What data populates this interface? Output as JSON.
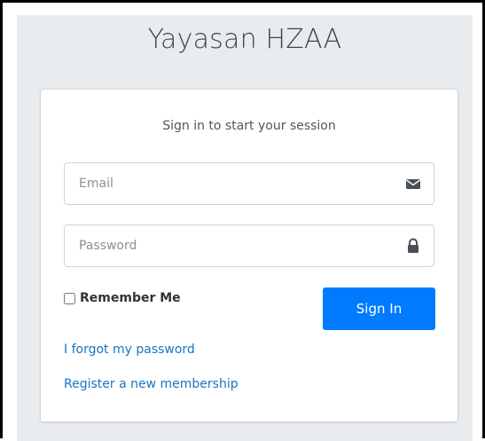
{
  "logo": {
    "text": "Yayasan HZAA"
  },
  "card": {
    "message": "Sign in to start your session",
    "email": {
      "placeholder": "Email",
      "value": "",
      "icon": "envelope-icon"
    },
    "password": {
      "placeholder": "Password",
      "value": "",
      "icon": "lock-icon"
    },
    "remember": {
      "label": "Remember Me",
      "checked": false
    },
    "signin_button": "Sign In",
    "links": {
      "forgot": "I forgot my password",
      "register": "Register a new membership"
    }
  },
  "colors": {
    "primary": "#007bff",
    "link": "#1a73c4",
    "background": "#e9ecef",
    "icon": "#495057"
  }
}
